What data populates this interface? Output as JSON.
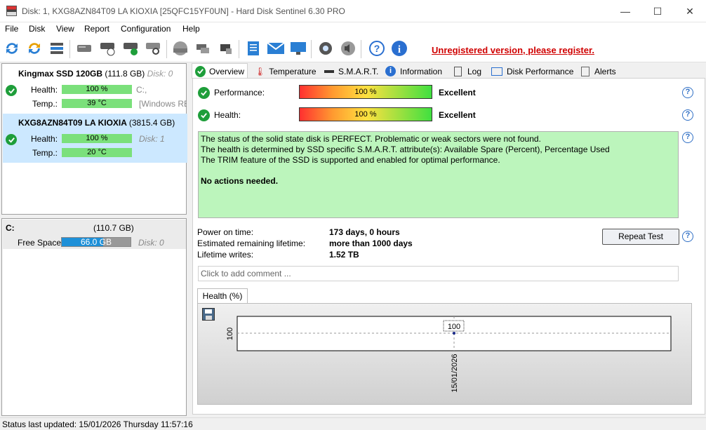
{
  "window": {
    "title": "Disk: 1, KXG8AZN84T09 LA KIOXIA [25QFC15YF0UN]  -  Hard Disk Sentinel 6.30 PRO"
  },
  "menu": [
    "File",
    "Disk",
    "View",
    "Report",
    "Configuration",
    "Help"
  ],
  "toolbar": {
    "icons": [
      "refresh-icon",
      "refresh-all-icon",
      "disk-list-icon",
      "disk-icon",
      "disk-schedule-icon",
      "disk-check-icon",
      "disk-search-icon",
      "disk-surface-icon",
      "disk-network-icon",
      "disk-usb-icon",
      "report-icon",
      "mail-icon",
      "monitor-icon",
      "gear-icon",
      "speaker-icon",
      "help-icon",
      "info-icon"
    ],
    "unregistered": "Unregistered version, please register."
  },
  "disks": [
    {
      "name": "Kingmax SSD 120GB",
      "size": "(111.8 GB)",
      "disk": "Disk: 0",
      "health_label": "Health:",
      "health": "100 %",
      "temp_label": "Temp.:",
      "temp": "39 °C",
      "drive": "C:,",
      "extra": "[Windows RE"
    },
    {
      "name": "KXG8AZN84T09 LA KIOXIA",
      "size": "(3815.4 GB)",
      "disk": "Disk: 1",
      "health_label": "Health:",
      "health": "100 %",
      "temp_label": "Temp.:",
      "temp": "20 °C"
    }
  ],
  "volume": {
    "letter": "C:",
    "size": "(110.7 GB)",
    "free_label": "Free Space",
    "free": "66.0 GB",
    "disk": "Disk: 0"
  },
  "tabs": [
    "Overview",
    "Temperature",
    "S.M.A.R.T.",
    "Information",
    "Log",
    "Disk Performance",
    "Alerts"
  ],
  "overview": {
    "performance_label": "Performance:",
    "performance_value": "100 %",
    "performance_rating": "Excellent",
    "performance_fraction": 1.0,
    "health_label": "Health:",
    "health_value": "100 %",
    "health_rating": "Excellent",
    "health_fraction": 1.0,
    "status_lines": [
      "The status of the solid state disk is PERFECT. Problematic or weak sectors were not found.",
      "The health is determined by SSD specific S.M.A.R.T. attribute(s):  Available Spare (Percent), Percentage Used",
      "The TRIM feature of the SSD is supported and enabled for optimal performance."
    ],
    "actions": "No actions needed.",
    "power_on_label": "Power on time:",
    "power_on": "173 days, 0 hours",
    "remaining_label": "Estimated remaining lifetime:",
    "remaining": "more than 1000 days",
    "writes_label": "Lifetime writes:",
    "writes": "1.52 TB",
    "repeat_button": "Repeat Test",
    "comment_placeholder": "Click to add comment ..."
  },
  "graph": {
    "tab": "Health (%)",
    "y_label": "100",
    "point_label": "100",
    "x_label": "15/01/2026"
  },
  "statusbar": {
    "text": "Status last updated: 15/01/2026 Thursday 11:57:16"
  }
}
